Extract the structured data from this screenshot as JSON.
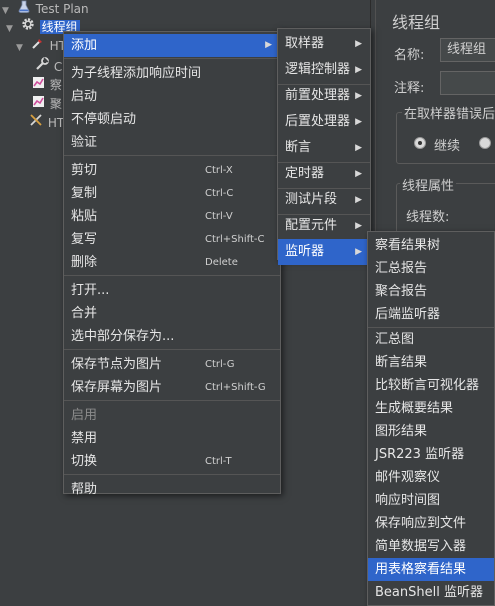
{
  "tree": {
    "root_label": "Test Plan",
    "thread_group_label": "线程组",
    "child_fragments": [
      "HT",
      "C",
      "察",
      "聚",
      "HT"
    ]
  },
  "right_panel": {
    "title": "线程组",
    "name_label": "名称:",
    "name_value": "线程组",
    "comment_label": "注释:",
    "error_group_title": "在取样器错误后要",
    "radio_continue": "继续",
    "props_title": "线程属性",
    "threads_label": "线程数:"
  },
  "context_menu": {
    "items": [
      {
        "label": "添加",
        "shortcut": "",
        "submenu": true,
        "highlighted": true
      },
      {
        "separator": true
      },
      {
        "label": "为子线程添加响应时间",
        "shortcut": ""
      },
      {
        "label": "启动",
        "shortcut": ""
      },
      {
        "label": "不停顿启动",
        "shortcut": ""
      },
      {
        "label": "验证",
        "shortcut": ""
      },
      {
        "separator": true
      },
      {
        "label": "剪切",
        "shortcut": "Ctrl-X"
      },
      {
        "label": "复制",
        "shortcut": "Ctrl-C"
      },
      {
        "label": "粘贴",
        "shortcut": "Ctrl-V"
      },
      {
        "label": "复写",
        "shortcut": "Ctrl+Shift-C"
      },
      {
        "label": "删除",
        "shortcut": "Delete"
      },
      {
        "separator": true
      },
      {
        "label": "打开...",
        "shortcut": ""
      },
      {
        "label": "合并",
        "shortcut": ""
      },
      {
        "label": "选中部分保存为...",
        "shortcut": ""
      },
      {
        "separator": true
      },
      {
        "label": "保存节点为图片",
        "shortcut": "Ctrl-G"
      },
      {
        "label": "保存屏幕为图片",
        "shortcut": "Ctrl+Shift-G"
      },
      {
        "separator": true
      },
      {
        "label": "启用",
        "shortcut": "",
        "disabled": true
      },
      {
        "label": "禁用",
        "shortcut": ""
      },
      {
        "label": "切换",
        "shortcut": "Ctrl-T"
      },
      {
        "separator": true
      },
      {
        "label": "帮助",
        "shortcut": ""
      }
    ]
  },
  "add_submenu": {
    "items": [
      {
        "label": "取样器",
        "submenu": true
      },
      {
        "label": "逻辑控制器",
        "submenu": true
      },
      {
        "separator": true
      },
      {
        "label": "前置处理器",
        "submenu": true
      },
      {
        "label": "后置处理器",
        "submenu": true
      },
      {
        "label": "断言",
        "submenu": true
      },
      {
        "separator": true
      },
      {
        "label": "定时器",
        "submenu": true
      },
      {
        "separator": true
      },
      {
        "label": "测试片段",
        "submenu": true
      },
      {
        "separator": true
      },
      {
        "label": "配置元件",
        "submenu": true
      },
      {
        "label": "监听器",
        "submenu": true,
        "highlighted": true
      }
    ]
  },
  "listener_submenu": {
    "items": [
      {
        "label": "察看结果树"
      },
      {
        "label": "汇总报告"
      },
      {
        "label": "聚合报告"
      },
      {
        "label": "后端监听器"
      },
      {
        "separator": true
      },
      {
        "label": "汇总图"
      },
      {
        "label": "断言结果"
      },
      {
        "label": "比较断言可视化器"
      },
      {
        "label": "生成概要结果"
      },
      {
        "label": "图形结果"
      },
      {
        "label": "JSR223 监听器"
      },
      {
        "label": "邮件观察仪"
      },
      {
        "label": "响应时间图"
      },
      {
        "label": "保存响应到文件"
      },
      {
        "label": "简单数据写入器"
      },
      {
        "label": "用表格察看结果",
        "highlighted": true
      },
      {
        "label": "BeanShell 监听器"
      }
    ]
  },
  "colors": {
    "background": "#3c3f41",
    "highlight": "#2f65ca",
    "text": "#e6e6e6",
    "disabled_text": "#8c8c8c"
  }
}
